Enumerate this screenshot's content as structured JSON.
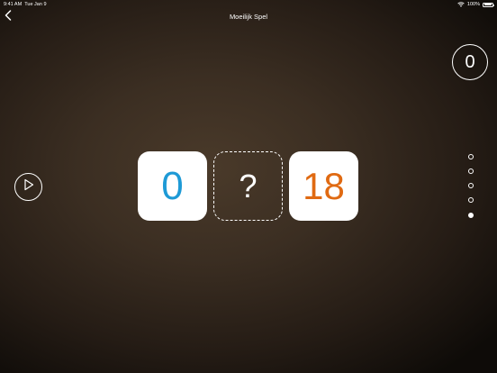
{
  "status_bar": {
    "time": "9:41 AM",
    "date": "Tue Jan 9",
    "battery": "100%",
    "icons": [
      "wifi-icon",
      "battery-icon"
    ]
  },
  "header": {
    "title": "Moeilijk Spel",
    "back_icon": "chevron-left-icon"
  },
  "score": {
    "value": "0"
  },
  "controls": {
    "play_icon": "play-icon"
  },
  "puzzle": {
    "left_value": "0",
    "middle_value": "?",
    "right_value": "18"
  },
  "progress": {
    "total": 5,
    "current": 5
  },
  "colors": {
    "left_number": "#1e9ad6",
    "right_number": "#e06a12",
    "tile_background": "#ffffff"
  }
}
